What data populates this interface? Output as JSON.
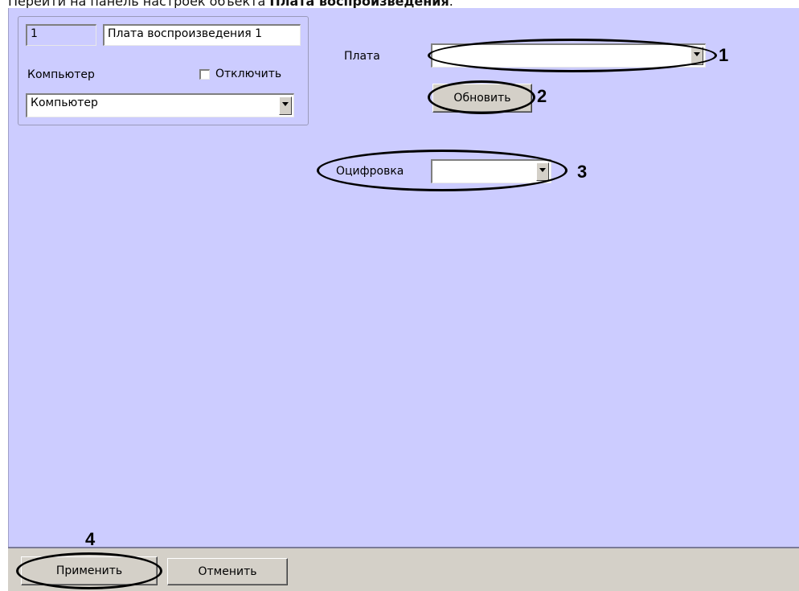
{
  "instruction": {
    "prefix": "Перейти на панель настроек объекта ",
    "bold": "Плата воспроизведения",
    "suffix": "."
  },
  "object": {
    "id": "1",
    "name": "Плата воспроизведения 1",
    "computer_label": "Компьютер",
    "disable_label": "Отключить",
    "disable_checked": false,
    "computer_value": "Компьютер"
  },
  "board": {
    "label": "Плата",
    "value": "",
    "refresh_label": "Обновить"
  },
  "digitization": {
    "label": "Оцифровка",
    "value": ""
  },
  "footer": {
    "apply_label": "Применить",
    "cancel_label": "Отменить"
  },
  "markers": [
    "1",
    "2",
    "3",
    "4"
  ]
}
